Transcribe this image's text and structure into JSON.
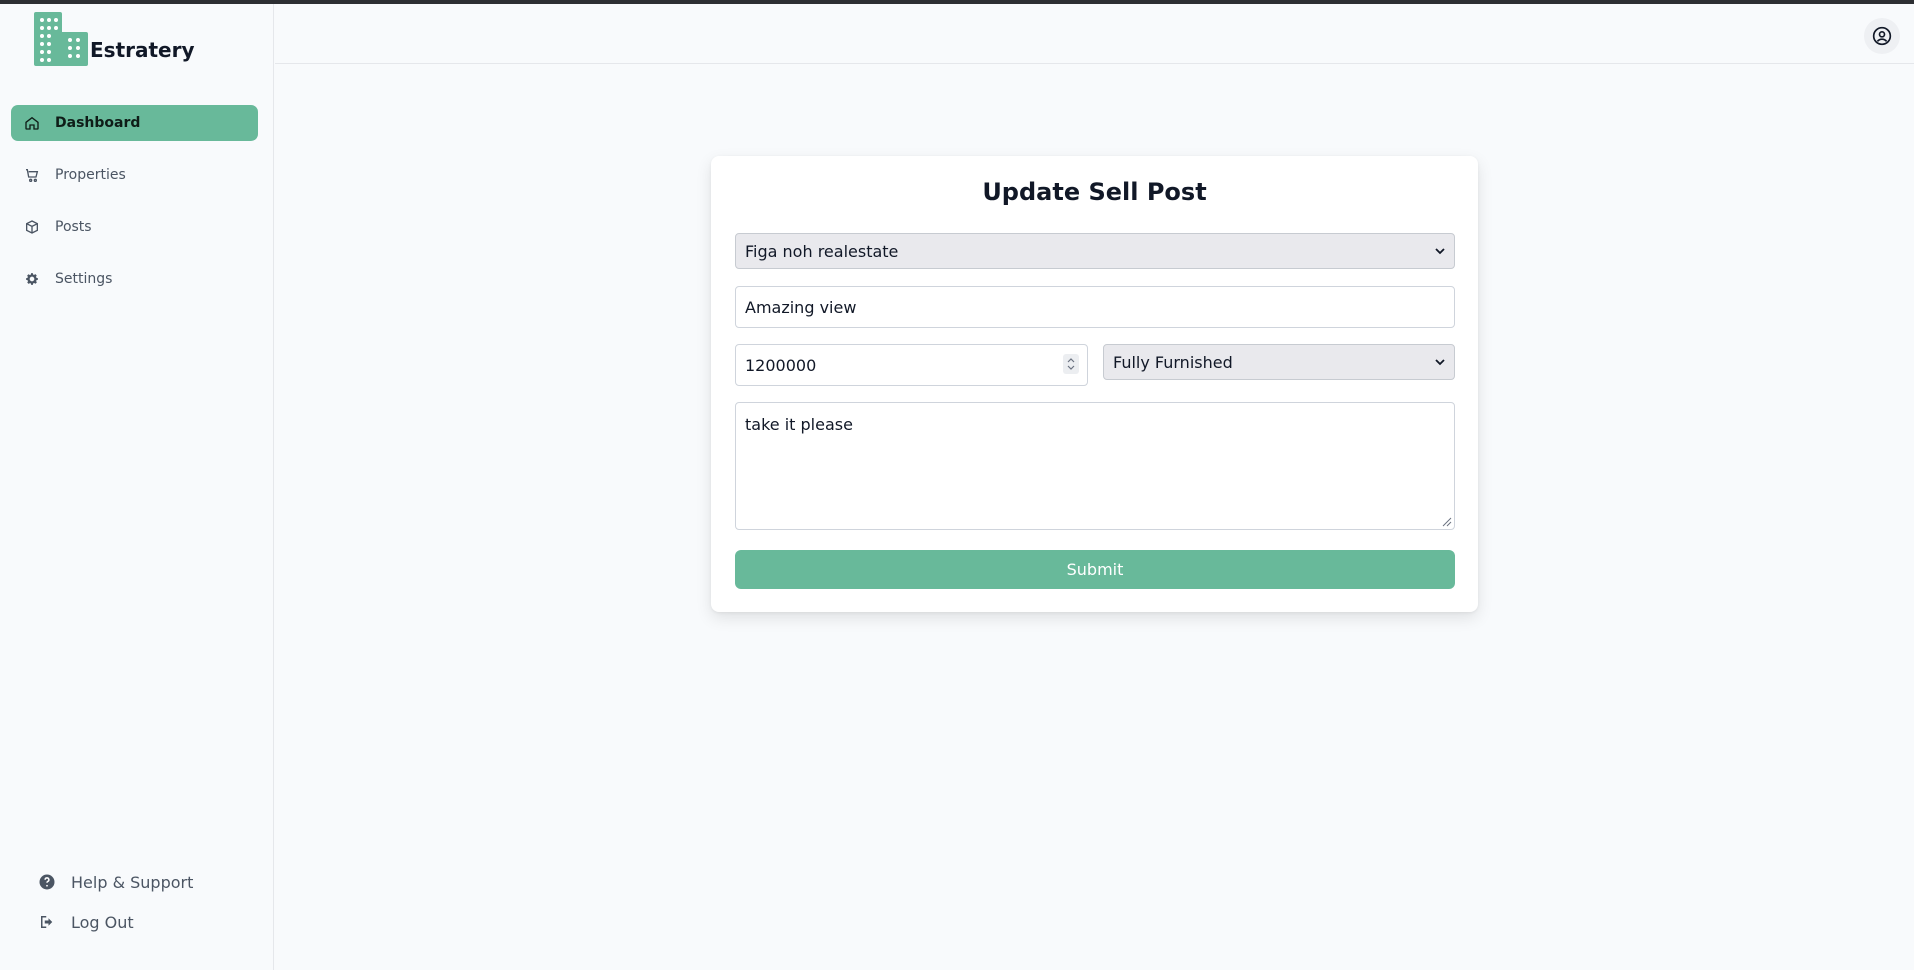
{
  "app": {
    "name": "Estratery"
  },
  "sidebar": {
    "items": [
      {
        "label": "Dashboard",
        "icon": "home-icon",
        "active": true
      },
      {
        "label": "Properties",
        "icon": "cart-icon",
        "active": false
      },
      {
        "label": "Posts",
        "icon": "box-icon",
        "active": false
      },
      {
        "label": "Settings",
        "icon": "gear-icon",
        "active": false
      }
    ],
    "bottom": [
      {
        "label": "Help & Support",
        "icon": "question-circle-icon"
      },
      {
        "label": "Log Out",
        "icon": "logout-icon"
      }
    ]
  },
  "header": {
    "profile_icon": "user-circle-icon"
  },
  "form": {
    "title": "Update Sell Post",
    "property_select_value": "Figa noh realestate",
    "title_input_value": "Amazing view",
    "price_input_value": "1200000",
    "furnishing_select_value": "Fully Furnished",
    "description_value": "take it please",
    "submit_label": "Submit"
  },
  "colors": {
    "accent": "#68b99a",
    "text": "#111827",
    "muted": "#4b5563"
  }
}
